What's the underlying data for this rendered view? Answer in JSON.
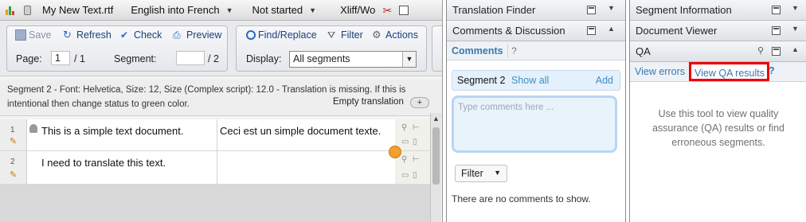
{
  "editor": {
    "title": "My New Text.rtf",
    "language_pair": "English into French",
    "status": "Not started",
    "xliff_label": "Xliff/Wo",
    "toolbar": {
      "save": "Save",
      "refresh": "Refresh",
      "check": "Check",
      "preview": "Preview",
      "find_replace": "Find/Replace",
      "filter": "Filter",
      "actions": "Actions",
      "page_label": "Page:",
      "page_value": "1",
      "page_total": "/ 1",
      "segment_label": "Segment:",
      "segment_value": "",
      "segment_total": "/ 2",
      "display_label": "Display:",
      "display_value": "All segments"
    },
    "info": {
      "message": "Segment 2 - Font: Helvetica, Size: 12, Size (Complex script): 12.0 - Translation is missing. If this is intentional then change status to green color.",
      "empty_translation": "Empty translation",
      "plus": "+"
    },
    "segments": [
      {
        "num": "1",
        "source": "This is a simple text document.",
        "target": "Ceci est un simple document texte."
      },
      {
        "num": "2",
        "source": "I need to translate this text.",
        "target": ""
      }
    ]
  },
  "middle": {
    "translation_finder": "Translation Finder",
    "comments_discussion": "Comments & Discussion",
    "tab_comments": "Comments",
    "tab_help": "?",
    "segment_label": "Segment 2",
    "show_all": "Show all",
    "add": "Add",
    "comment_placeholder": "Type comments here ...",
    "filter_label": "Filter",
    "no_comments": "There are no comments to show."
  },
  "right": {
    "segment_information": "Segment Information",
    "document_viewer": "Document Viewer",
    "qa": "QA",
    "tab_view_errors": "View errors",
    "tab_view_qa_results": "View QA results",
    "tab_help": "?",
    "qa_message": "Use this tool to view quality assurance (QA) results or find erroneous segments."
  },
  "colors": {
    "link_blue": "#3d8fc7",
    "highlight_red": "#e00000",
    "comment_box_border": "#b9d6f2"
  }
}
